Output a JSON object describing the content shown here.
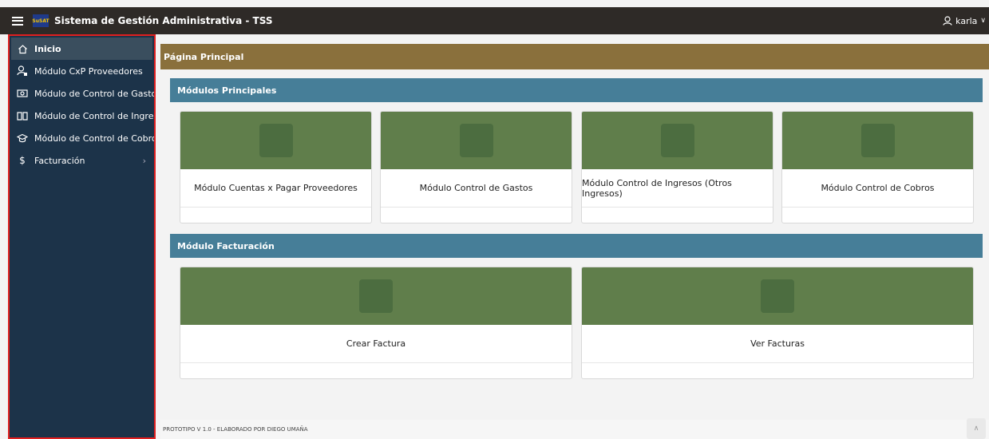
{
  "app": {
    "title": "Sistema de Gestión Administrativa - TSS",
    "logo_text": "SuSAT"
  },
  "user": {
    "name": "karla"
  },
  "sidebar": {
    "items": [
      {
        "label": "Inicio",
        "icon": "home-icon"
      },
      {
        "label": "Módulo CxP Proveedores",
        "icon": "user-lock-icon"
      },
      {
        "label": "Módulo de Control de Gasto...",
        "icon": "money-icon"
      },
      {
        "label": "Módulo de Control de Ingresos",
        "icon": "book-icon"
      },
      {
        "label": "Módulo de Control de Cobros",
        "icon": "graduation-icon"
      },
      {
        "label": "Facturación",
        "icon": "dollar-icon"
      }
    ]
  },
  "page": {
    "title": "Página Principal"
  },
  "regions": {
    "principales": {
      "title": "Módulos Principales",
      "cards": [
        "Módulo Cuentas x Pagar Proveedores",
        "Módulo Control de Gastos",
        "Módulo Control de Ingresos (Otros Ingresos)",
        "Módulo Control de Cobros"
      ]
    },
    "facturacion": {
      "title": "Módulo Facturación",
      "cards": [
        "Crear Factura",
        "Ver Facturas"
      ]
    }
  },
  "footer": {
    "text": "PROTOTIPO V 1.0 - ELABORADO POR DIEGO UMAÑA"
  },
  "colors": {
    "topbar": "#2e2a27",
    "sidebar": "#1c3349",
    "page_header": "#8a703c",
    "region_header": "#467e98",
    "card": "#607e4b"
  }
}
